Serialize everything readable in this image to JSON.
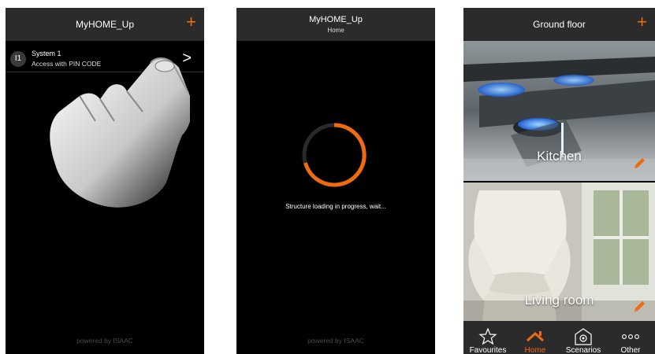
{
  "accent_color": "#f06a10",
  "screen1": {
    "app_title": "MyHOME_Up",
    "add_icon": "+",
    "system": {
      "badge": "I1",
      "name": "System 1",
      "access": "Access with PIN CODE",
      "chevron": ">"
    },
    "footer": "powered by ISAAC"
  },
  "screen2": {
    "app_title": "MyHOME_Up",
    "subtitle": "Home",
    "loading_text": "Structure loading in progress, wait...",
    "footer": "powered by ISAAC"
  },
  "screen3": {
    "title": "Ground floor",
    "add_icon": "+",
    "rooms": [
      {
        "name": "Kitchen"
      },
      {
        "name": "Living room"
      }
    ],
    "tabs": [
      {
        "label": "Favourites",
        "icon": "star-icon",
        "active": false
      },
      {
        "label": "Home",
        "icon": "house-icon",
        "active": true
      },
      {
        "label": "Scenarios",
        "icon": "scenario-icon",
        "active": false
      },
      {
        "label": "Other",
        "icon": "more-dots-icon",
        "active": false
      }
    ]
  }
}
